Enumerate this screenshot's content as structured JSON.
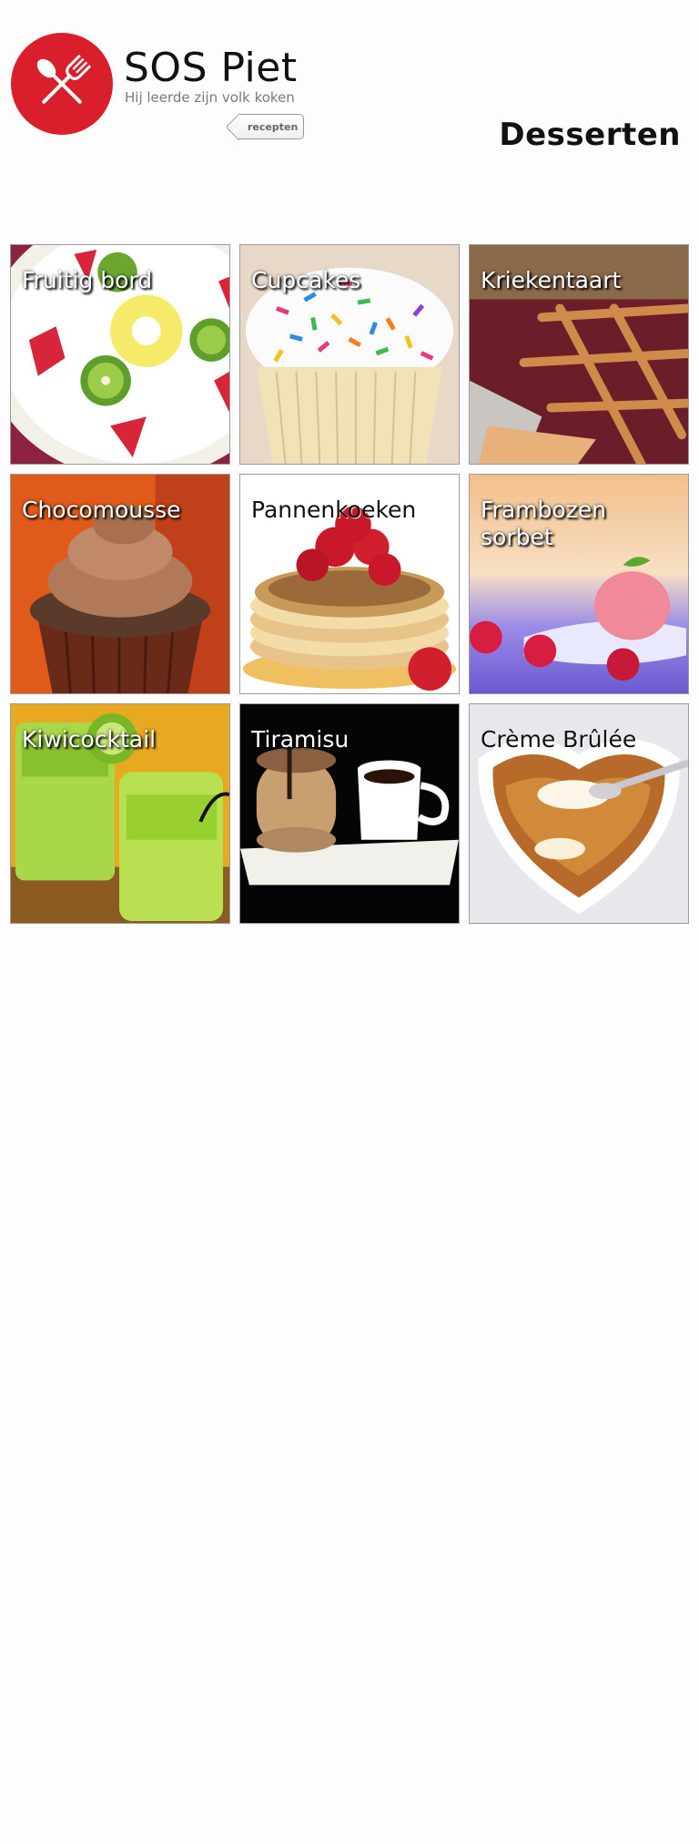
{
  "header": {
    "brand_title": "SOS Piet",
    "brand_tagline": "Hij leerde zijn volk koken",
    "back_label": "recepten",
    "section_title": "Desserten",
    "logo_icon": "spoon-fork-icon",
    "brand_color": "#d91f2b"
  },
  "recipes": [
    {
      "label": "Fruitig bord",
      "image": "fruit-plate-image"
    },
    {
      "label": "Cupcakes",
      "image": "cupcake-image"
    },
    {
      "label": "Kriekentaart",
      "image": "cherry-tart-image"
    },
    {
      "label": "Chocomousse",
      "image": "chocolate-mousse-image"
    },
    {
      "label": "Pannenkoeken",
      "image": "pancakes-image"
    },
    {
      "label": "Frambozen sorbet",
      "image": "raspberry-sorbet-image"
    },
    {
      "label": "Kiwicocktail",
      "image": "kiwi-cocktail-image"
    },
    {
      "label": "Tiramisu",
      "image": "tiramisu-image"
    },
    {
      "label": "Crème Brûlée",
      "image": "creme-brulee-image"
    }
  ]
}
